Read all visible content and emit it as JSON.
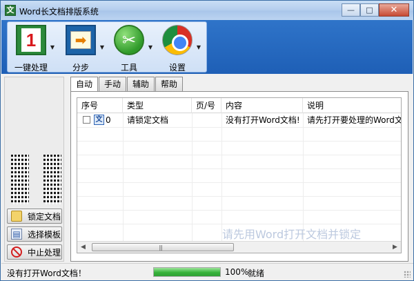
{
  "window": {
    "title": "Word长文档排版系统",
    "app_icon": "文",
    "minimize": "—",
    "maximize": "□",
    "close": "✕"
  },
  "ribbon": {
    "buttons": [
      {
        "label": "一键处理",
        "icon": "one-click-icon",
        "glyph": "1"
      },
      {
        "label": "分步",
        "icon": "step-arrow-icon",
        "glyph": "➡"
      },
      {
        "label": "工具",
        "icon": "tools-icon",
        "glyph": "✂"
      },
      {
        "label": "设置",
        "icon": "chrome-settings-icon",
        "glyph": ""
      }
    ],
    "dropdown_glyph": "▼"
  },
  "left_panel": {
    "buttons": [
      {
        "label": "锁定文档",
        "icon": "lock-document-icon"
      },
      {
        "label": "选择模板",
        "icon": "template-icon",
        "glyph": "▤"
      },
      {
        "label": "中止处理",
        "icon": "stop-icon"
      }
    ]
  },
  "tabs": [
    "自动",
    "手动",
    "辅助",
    "帮助"
  ],
  "table": {
    "columns": [
      "序号",
      "类型",
      "页/号",
      "内容",
      "说明"
    ],
    "rows": [
      {
        "checked": false,
        "row_icon": "文",
        "seq": "0",
        "type": "请锁定文档",
        "page": "",
        "content": "没有打开Word文档!",
        "note": "请先打开要处理的Word文档"
      }
    ],
    "watermark": "请先用Word打开文档并锁定",
    "scroll_left": "◀",
    "scroll_right": "▶",
    "scroll_grip": "|||"
  },
  "status": {
    "message": "没有打开Word文档！",
    "progress": 1.0,
    "progress_text": "100%",
    "ready": "就绪"
  },
  "colors": {
    "ribbon_blue": "#1e5fb6",
    "progress_green": "#37b33a",
    "close_red": "#c74a34"
  }
}
